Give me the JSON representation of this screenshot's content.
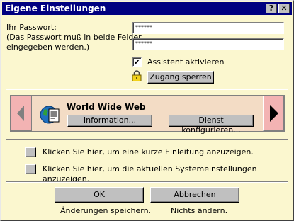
{
  "window": {
    "title": "Eigene Einstellungen",
    "help_label": "?",
    "close_label": "✕"
  },
  "password": {
    "label": "Ihr Passwort:",
    "hint_line1": "(Das Passwort muß in beide Felder",
    "hint_line2": "eingegeben werden.)",
    "field1_value": "******",
    "field2_value": "******"
  },
  "assistant": {
    "checkbox_checked": true,
    "checkmark": "✔",
    "label": "Assistent aktivieren"
  },
  "lock": {
    "button_label": "Zugang sperren"
  },
  "service": {
    "title": "World Wide Web",
    "info_button": "Information...",
    "configure_button": "Dienst konfigurieren..."
  },
  "help": {
    "intro_label": "Klicken Sie hier, um eine kurze Einleitung anzuzeigen.",
    "settings_label": "Klicken Sie hier, um die aktuellen Systemeinstellungen anzuzeigen."
  },
  "footer": {
    "ok_label": "OK",
    "ok_caption": "Änderungen speichern.",
    "cancel_label": "Abbrechen",
    "cancel_caption": "Nichts ändern."
  },
  "colors": {
    "titlebar": "#000080",
    "background": "#fbf7cf",
    "service_panel": "#f3dcc5",
    "arrow_button": "#f3b3b3",
    "button_face": "#c0c0c0"
  },
  "icons": {
    "lock": "padlock-icon",
    "globe": "globe-document-icon",
    "prev": "triangle-left-icon",
    "next": "triangle-right-icon"
  }
}
